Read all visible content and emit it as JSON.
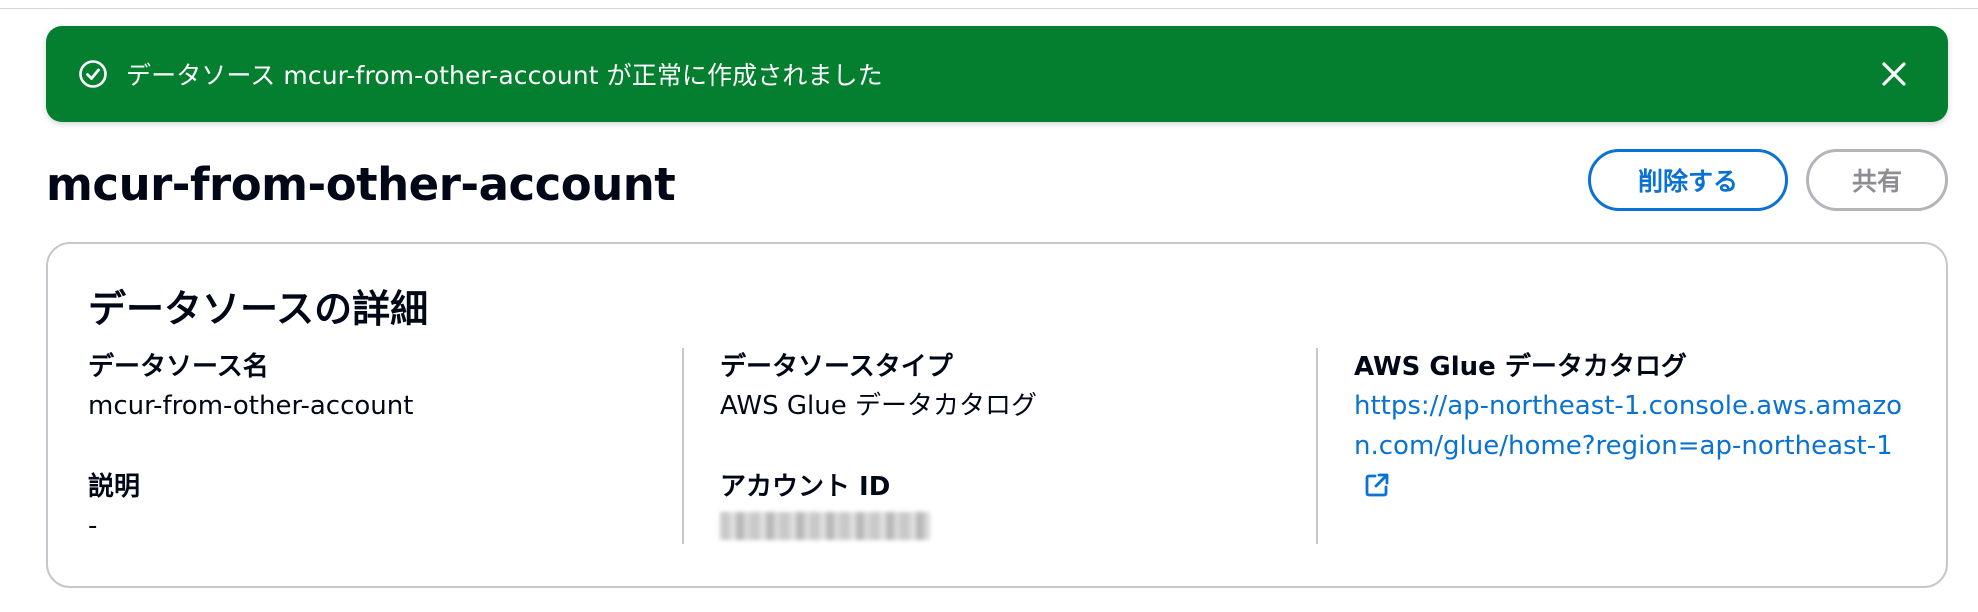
{
  "flash": {
    "message": "データソース mcur-from-other-account が正常に作成されました",
    "status_icon": "check-circle-icon",
    "close_icon": "close-icon",
    "color": "#037f2f"
  },
  "header": {
    "title": "mcur-from-other-account",
    "delete_label": "削除する",
    "share_label": "共有"
  },
  "details": {
    "title": "データソースの詳細",
    "columns": [
      {
        "fields": [
          {
            "label": "データソース名",
            "value": "mcur-from-other-account"
          },
          {
            "label": "説明",
            "value": "-"
          }
        ]
      },
      {
        "fields": [
          {
            "label": "データソースタイプ",
            "value": "AWS Glue データカタログ"
          },
          {
            "label": "アカウント ID",
            "value": ""
          }
        ]
      },
      {
        "fields": [
          {
            "label": "AWS Glue データカタログ",
            "link": "https://ap-northeast-1.console.aws.amazon.com/glue/home?region=ap-northeast-1",
            "link_icon": "external-link-icon"
          }
        ]
      }
    ]
  },
  "colors": {
    "link": "#0972d3",
    "success": "#037f2f",
    "disabled": "#8d8d94"
  }
}
